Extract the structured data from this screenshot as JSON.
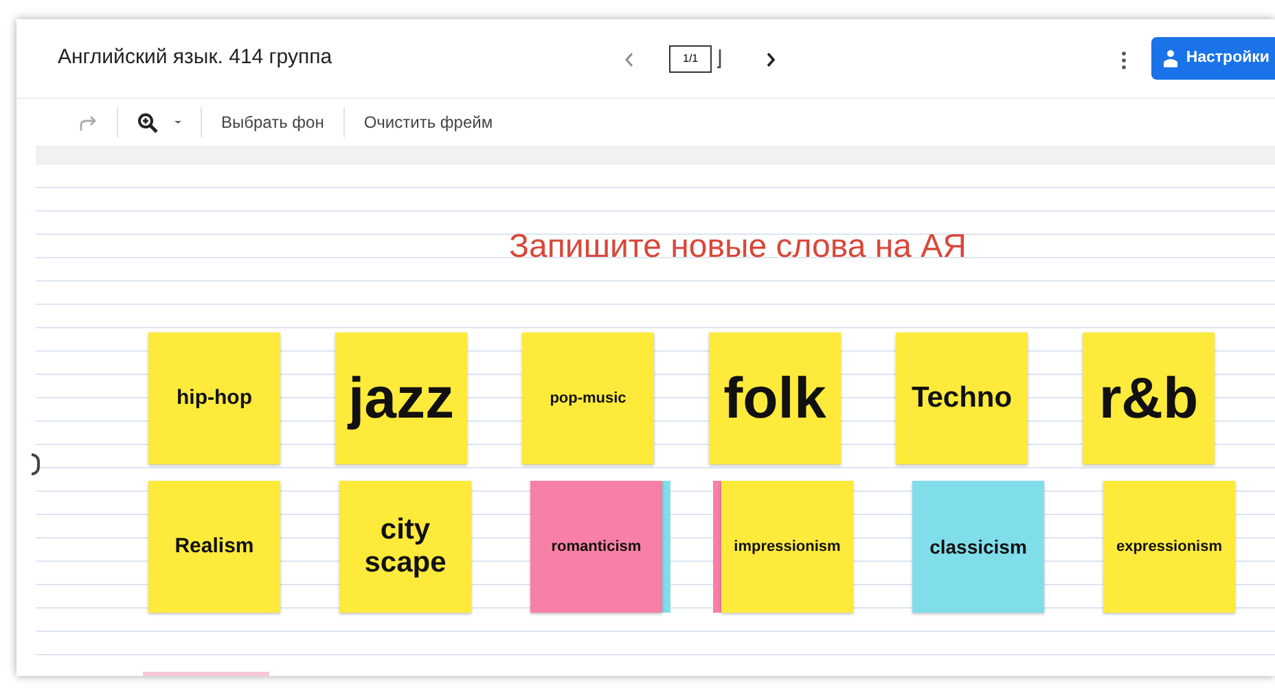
{
  "header": {
    "title": "Английский язык. 414 группа",
    "page_counter": "1/1",
    "settings_button": "Настройки"
  },
  "toolbar": {
    "items": [
      {
        "kind": "redo"
      },
      {
        "kind": "zoom"
      },
      {
        "kind": "text",
        "label": "Выбрать фон"
      },
      {
        "kind": "text",
        "label": "Очистить фрейм"
      }
    ]
  },
  "frame": {
    "heading": "Запишите новые слова на АЯ",
    "rows": [
      [
        {
          "text": "hip-hop",
          "color": "#fdea3b"
        },
        {
          "text": "jazz",
          "color": "#fdea3b"
        },
        {
          "text": "pop-music",
          "color": "#fdea3b"
        },
        {
          "text": "folk",
          "color": "#fdea3b"
        },
        {
          "text": "Techno",
          "color": "#fdea3b"
        },
        {
          "text": "r&b",
          "color": "#fdea3b"
        }
      ],
      [
        {
          "text": "Realism",
          "color": "#fdea3b"
        },
        {
          "text": "city scape",
          "color": "#fdea3b"
        },
        {
          "text": "romanticism",
          "color": "#f87fa5",
          "underlay": {
            "color": "#80deea",
            "left": false
          }
        },
        {
          "text": "impressionism",
          "color": "#fdea3b",
          "underlay": {
            "color": "#f87fa5",
            "left": true
          }
        },
        {
          "text": "classicism",
          "color": "#80deea"
        },
        {
          "text": "expressionism",
          "color": "#fdea3b"
        }
      ]
    ],
    "peek_note": {
      "color": "#f8c8d8"
    }
  }
}
